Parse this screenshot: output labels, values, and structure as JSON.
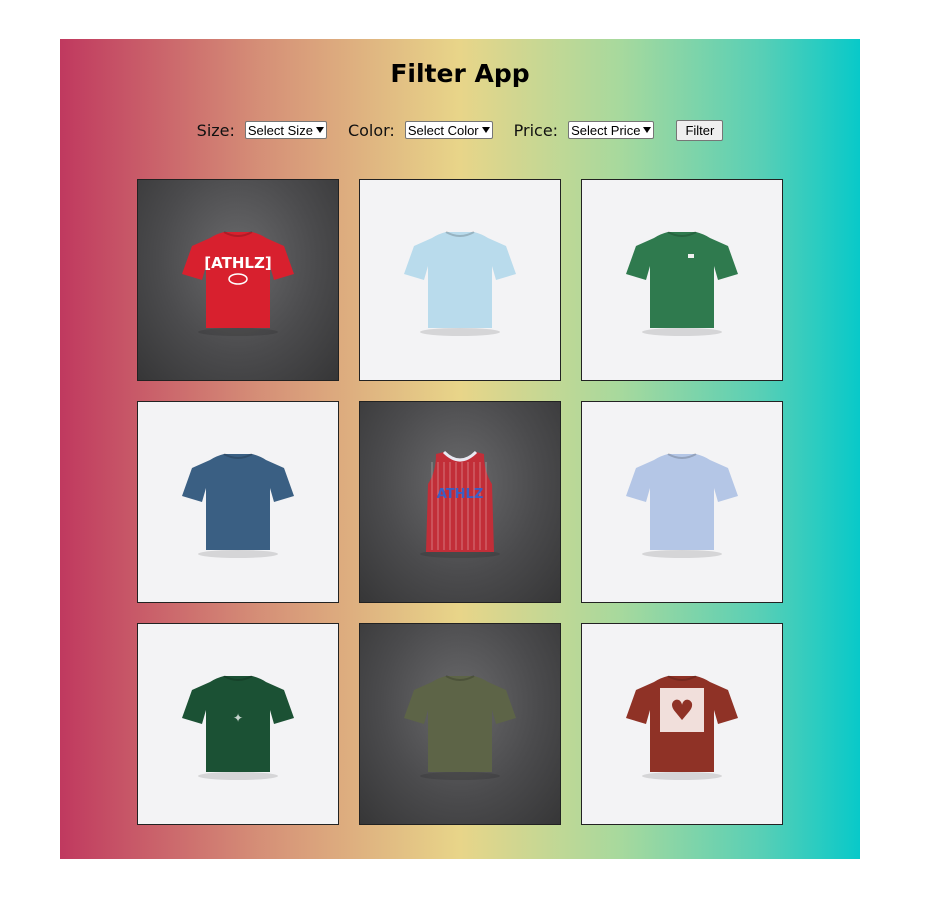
{
  "app": {
    "title": "Filter App"
  },
  "filters": {
    "size": {
      "label": "Size:",
      "selected": "Select Size"
    },
    "color": {
      "label": "Color:",
      "selected": "Select Color"
    },
    "price": {
      "label": "Price:",
      "selected": "Select Price"
    },
    "button_label": "Filter"
  },
  "products": [
    {
      "image": "red-tshirt-athlz-graphic",
      "bg": "dark",
      "shirt_color": "#d8202e",
      "print": "ATHLZ"
    },
    {
      "image": "light-blue-tshirt",
      "bg": "light",
      "shirt_color": "#b9dbec"
    },
    {
      "image": "green-tshirt-small-logo",
      "bg": "light",
      "shirt_color": "#2f7a4e"
    },
    {
      "image": "navy-blue-tshirt",
      "bg": "light",
      "shirt_color": "#3a5f83"
    },
    {
      "image": "red-striped-basketball-jersey-athlz",
      "bg": "dark",
      "shirt_color": "#c22e38",
      "print": "ATHLZ"
    },
    {
      "image": "periwinkle-tshirt",
      "bg": "light",
      "shirt_color": "#b4c6e6"
    },
    {
      "image": "dark-green-tshirt-graphic",
      "bg": "light",
      "shirt_color": "#1b5134"
    },
    {
      "image": "olive-tshirt",
      "bg": "dark",
      "shirt_color": "#5d6447"
    },
    {
      "image": "maroon-tshirt-heart-graphic",
      "bg": "light",
      "shirt_color": "#8f3226"
    }
  ]
}
